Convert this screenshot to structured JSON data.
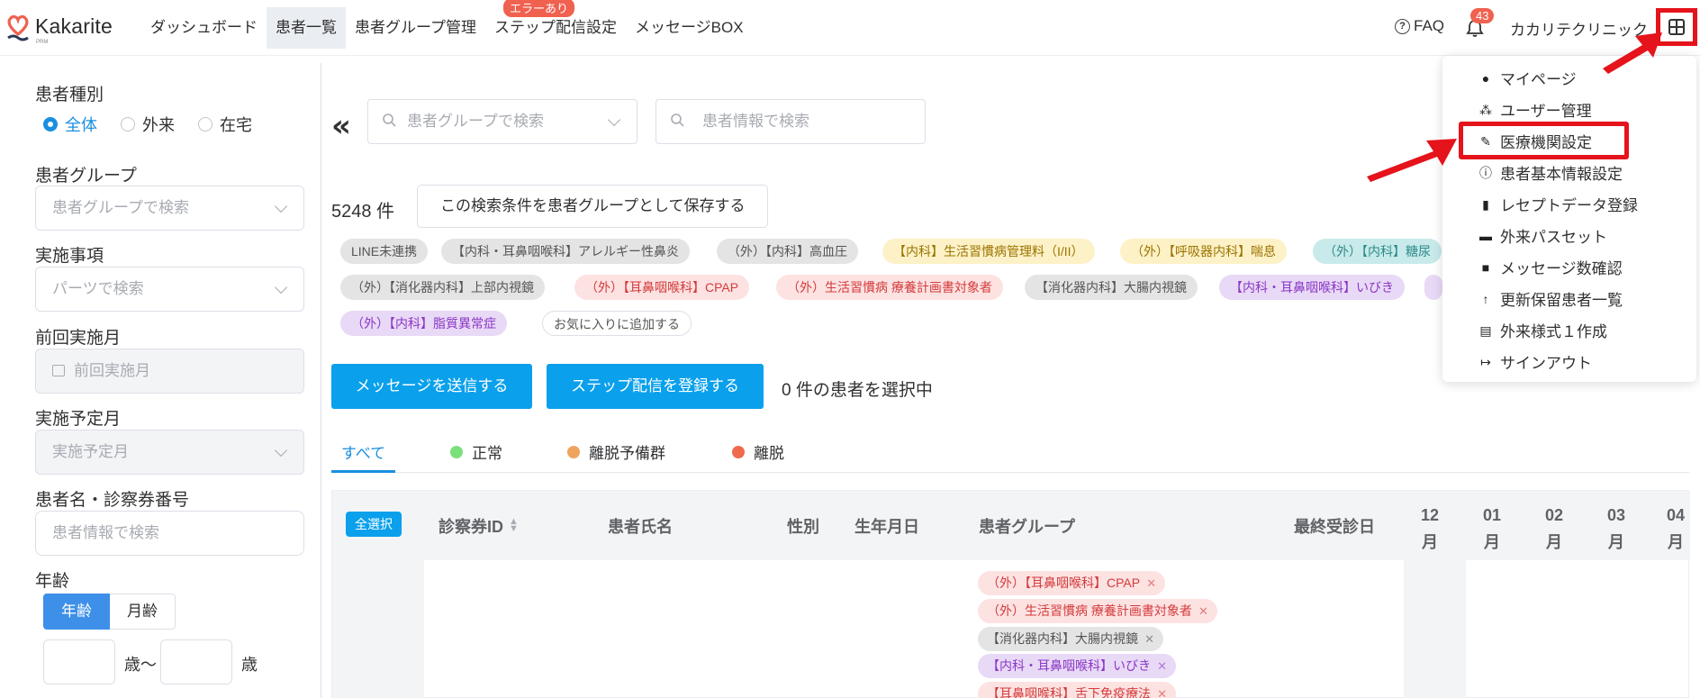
{
  "header": {
    "logo": "Kakarite",
    "logo_sub": "PRM",
    "nav": [
      "ダッシュボード",
      "患者一覧",
      "患者グループ管理",
      "ステップ配信設定",
      "メッセージBOX"
    ],
    "nav_badge": "エラーあり",
    "faq": "FAQ",
    "bell_count": "43",
    "clinic_name": "カカリテクリニック"
  },
  "sidebar": {
    "type_label": "患者種別",
    "type_options": [
      "全体",
      "外来",
      "在宅"
    ],
    "type_selected": "全体",
    "group_label": "患者グループ",
    "group_placeholder": "患者グループで検索",
    "item_label": "実施事項",
    "item_placeholder": "パーツで検索",
    "prev_label": "前回実施月",
    "prev_placeholder": "前回実施月",
    "plan_label": "実施予定月",
    "plan_placeholder": "実施予定月",
    "name_label": "患者名・診察券番号",
    "name_placeholder": "患者情報で検索",
    "age_label": "年齢",
    "age_modes": [
      "年齢",
      "月齢"
    ],
    "age_from_suffix": "歳〜",
    "age_to_suffix": "歳"
  },
  "main": {
    "group_search_placeholder": "患者グループで検索",
    "info_search_placeholder": "患者情報で検索",
    "count": "5248 件",
    "save_button": "この検索条件を患者グループとして保存する",
    "filter_tags": [
      "LINE未連携",
      "【内科・耳鼻咽喉科】アレルギー性鼻炎",
      "（外）【内科】高血圧",
      "【内科】生活習慣病管理料（I/II）",
      "（外）【呼吸器内科】喘息",
      "（外）【内科】糖尿",
      "（外）【消化器内科】上部内視鏡",
      "（外）【耳鼻咽喉科】CPAP",
      "（外）生活習慣病 療養計画書対象者",
      "【消化器内科】大腸内視鏡",
      "【内科・耳鼻咽喉科】いびき",
      "（外）【内科】脂質異常症",
      "お気に入りに追加する"
    ],
    "send_message_button": "メッセージを送信する",
    "step_button": "ステップ配信を登録する",
    "selected_text": "0 件の患者を選択中",
    "tabs": [
      {
        "label": "すべて",
        "color": ""
      },
      {
        "label": "正常",
        "color": "#7be07b"
      },
      {
        "label": "離脱予備群",
        "color": "#f0a35e"
      },
      {
        "label": "離脱",
        "color": "#ef6a4d"
      }
    ],
    "table": {
      "select_all": "全選択",
      "headers": [
        "診察券ID",
        "患者氏名",
        "性別",
        "生年月日",
        "患者グループ",
        "最終受診日"
      ],
      "months": [
        {
          "num": "12",
          "unit": "月"
        },
        {
          "num": "01",
          "unit": "月"
        },
        {
          "num": "02",
          "unit": "月"
        },
        {
          "num": "03",
          "unit": "月"
        },
        {
          "num": "04",
          "unit": "月"
        }
      ],
      "row_groups": [
        "（外）【耳鼻咽喉科】CPAP",
        "（外）生活習慣病 療養計画書対象者",
        "【消化器内科】大腸内視鏡",
        "【内科・耳鼻咽喉科】いびき",
        "【耳鼻咽喉科】舌下免疫療法"
      ]
    }
  },
  "dropdown": {
    "items": [
      {
        "icon": "user-icon",
        "label": "マイページ"
      },
      {
        "icon": "users-icon",
        "label": "ユーザー管理"
      },
      {
        "icon": "pen-icon",
        "label": "医療機関設定"
      },
      {
        "icon": "info-icon",
        "label": "患者基本情報設定"
      },
      {
        "icon": "file-upload-icon",
        "label": "レセプトデータ登録"
      },
      {
        "icon": "medkit-icon",
        "label": "外来パスセット"
      },
      {
        "icon": "message-icon",
        "label": "メッセージ数確認"
      },
      {
        "icon": "person-up-icon",
        "label": "更新保留患者一覧"
      },
      {
        "icon": "print-icon",
        "label": "外来様式１作成"
      },
      {
        "icon": "sign-out-icon",
        "label": "サインアウト"
      }
    ]
  },
  "colors": {
    "accent": "#0aa0ec",
    "highlight": "#e5131b"
  }
}
